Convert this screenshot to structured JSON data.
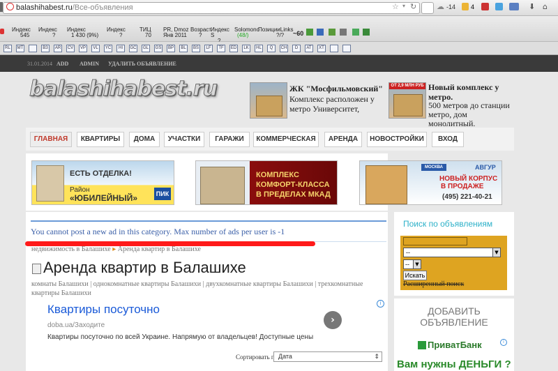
{
  "browser": {
    "url_domain": "balashihabest.ru",
    "url_path": "/Все-объявления",
    "weather": "-14",
    "count_badge": "4",
    "toolbar1": [
      {
        "title": "Индекс",
        "sub": "545"
      },
      {
        "title": "Индекс",
        "sub": "?"
      },
      {
        "title": "Индекс",
        "sub": "1 430 (9%)"
      },
      {
        "title": "Индекс",
        "sub": "?"
      },
      {
        "title": "ТИЦ",
        "sub": "70"
      },
      {
        "title": "PR, Dmoz",
        "sub": "Янв 2011"
      },
      {
        "title": "Возраст",
        "sub": "?"
      },
      {
        "title": "Индекс S",
        "sub": "?"
      },
      {
        "title": "Solomono",
        "sub": "(48/)"
      },
      {
        "title": "ПозицииLinks",
        "sub": "?/?"
      }
    ],
    "extra_num": "~60",
    "toolbar2": [
      "RL",
      "MT",
      "",
      "ВЗ",
      "AR",
      "CV",
      "VP",
      "VL",
      "YC",
      "HI",
      "GC",
      "GL",
      "GS",
      "BP",
      "BL",
      "BS",
      "LF",
      "TF",
      "ED",
      "LK",
      "HL",
      "Q",
      "CH",
      "D",
      "AT",
      "XT",
      "",
      ""
    ]
  },
  "admin_bar": {
    "date": "31.01.2014",
    "items": [
      "ADD",
      "ADMIN",
      "УДАЛИТЬ ОБЪЯВЛЕНИЕ"
    ]
  },
  "header": {
    "logo": "balashihabest.ru",
    "ad1": {
      "title": "ЖК \"Мосфильмовский\"",
      "text": "Комплекс расположен у метро Университет,"
    },
    "ad2": {
      "badge": "ОТ 2,9 МЛН РУБ",
      "title": "Новый комплекс у метро.",
      "text": "500 метров до станции метро, дом монолитный."
    }
  },
  "nav": [
    "ГЛАВНАЯ",
    "КВАРТИРЫ",
    "ДОМА",
    "УЧАСТКИ",
    "ГАРАЖИ",
    "КОММЕРЧЕСКАЯ",
    "АРЕНДА",
    "НОВОСТРОЙКИ",
    "ВХОД"
  ],
  "banners": {
    "b1": {
      "line1": "ЕСТЬ ОТДЕЛКА!",
      "line2": "Район",
      "line3": "«ЮБИЛЕЙНЫЙ»",
      "logo": "ПИК"
    },
    "b2": {
      "line1": "КОМПЛЕКС",
      "line2": "КОМФОРТ-КЛАССА",
      "line3": "В ПРЕДЕЛАХ МКАД"
    },
    "b3": {
      "brand": "АВГУР",
      "tag": "МОСКВА",
      "line1": "НОВЫЙ КОРПУС",
      "line2": "В ПРОДАЖЕ",
      "phone": "(495) 221-40-21"
    }
  },
  "main": {
    "error": "You cannot post a new ad in this category. Max number of ads per user is -1",
    "breadcrumb": [
      "недвижимость в Балашихе",
      "Аренда квартир в Балашихе"
    ],
    "title": "Аренда квартир в Балашихе",
    "tags": "комнаты Балашихи | однокомнатные квартиры Балашихи | двухкомнатные квартиры Балашихи | трехкомнатные квартиры Балашихи",
    "google_ad": {
      "title": "Квартиры посуточно",
      "domain": "doba.ua/Заходите",
      "text": "Квартиры посуточно по всей Украине. Напрямую от владельцев! Доступные цены"
    },
    "sort_label": "Сортировать по",
    "sort_value": "Дата"
  },
  "sidebar": {
    "search_title": "Поиск по объявлениям",
    "select1": "--",
    "select2": "--",
    "search_button": "Искать",
    "advanced": "Расширенный поиск",
    "add_ad": "ДОБАВИТЬ ОБЪЯВЛЕНИЕ",
    "bank": "ПриватБанк",
    "bank_text": "Вам нужны ДЕНЬГИ ?"
  },
  "colors": {
    "accent": "#c0392b",
    "link": "#3a5fa8",
    "search": "#dea421",
    "sidebar_title": "#2bb0c8"
  }
}
